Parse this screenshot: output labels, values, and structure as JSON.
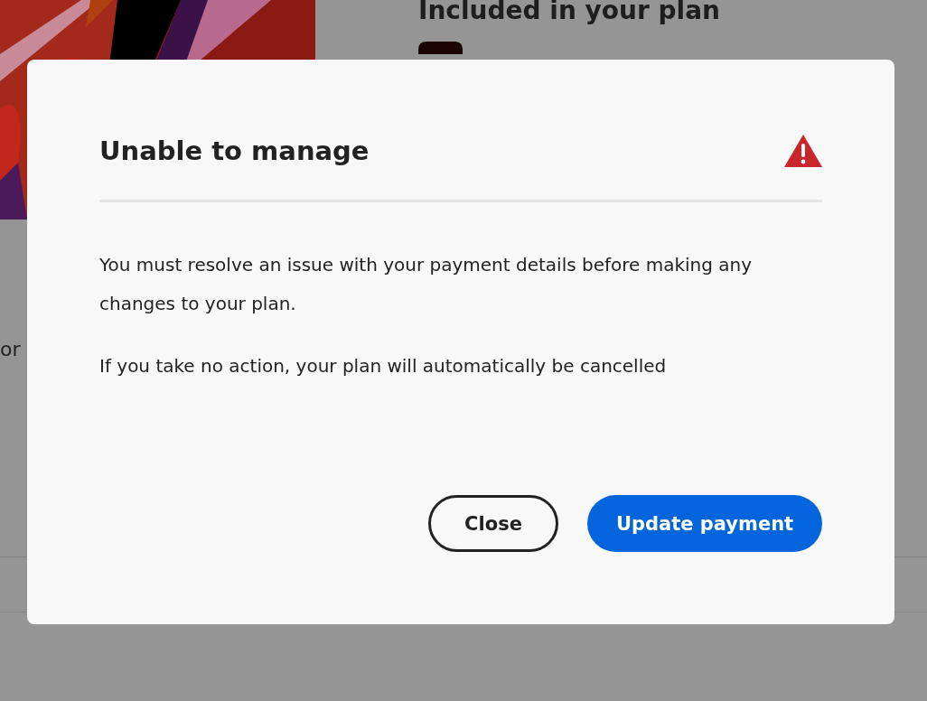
{
  "page": {
    "heading": "Included in your plan",
    "side_text": "or"
  },
  "dialog": {
    "title": "Unable to manage",
    "paragraphs": [
      "You must resolve an issue with your payment details before making any changes to your plan.",
      "If you take no action, your plan will automatically be cancelled"
    ],
    "buttons": [
      {
        "label": "Close",
        "kind": "secondary"
      },
      {
        "label": "Update payment",
        "kind": "primary"
      }
    ]
  }
}
